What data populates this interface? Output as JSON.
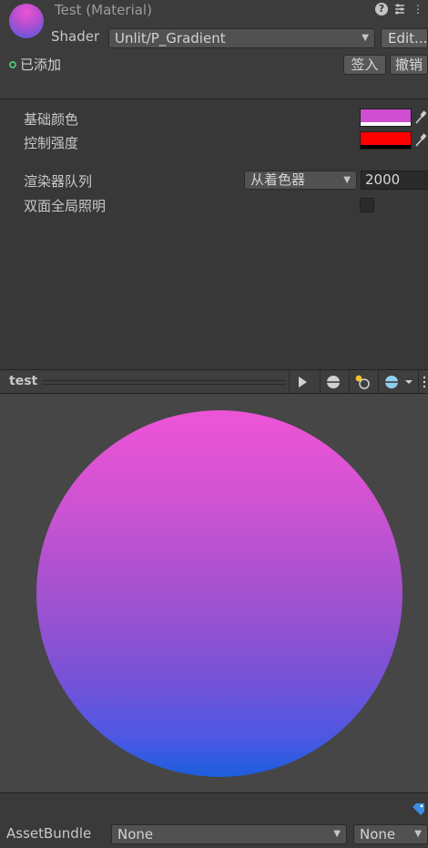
{
  "header": {
    "title": "Test (Material)",
    "shader_label": "Shader",
    "shader_value": "Unlit/P_Gradient",
    "edit_label": "Edit...",
    "added_label": "已添加",
    "sign_in_label": "签入",
    "revert_label": "撤销"
  },
  "properties": {
    "base_color": {
      "label": "基础颜色",
      "color": "#cf4dd0"
    },
    "control_strength": {
      "label": "控制强度",
      "color": "#ff0000"
    },
    "render_queue": {
      "label": "渲染器队列",
      "mode": "从着色器",
      "value": "2000"
    },
    "double_sided_gi": {
      "label": "双面全局照明",
      "checked": false
    }
  },
  "preview": {
    "title": "test",
    "gradient_top": "#ee54d6",
    "gradient_bottom": "#1b5edd"
  },
  "footer": {
    "assetbundle_label": "AssetBundle",
    "bundle_value": "None",
    "variant_value": "None"
  }
}
